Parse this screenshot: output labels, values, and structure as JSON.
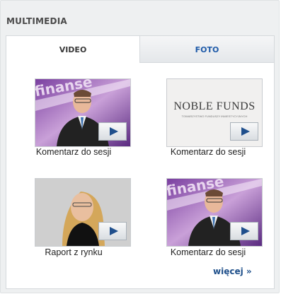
{
  "widget": {
    "title": "MULTIMEDIA"
  },
  "tabs": [
    {
      "label": "VIDEO",
      "active": true
    },
    {
      "label": "FOTO",
      "active": false
    }
  ],
  "videos": [
    {
      "caption": "Komentarz do sesji",
      "thumb": "finance-man"
    },
    {
      "caption": "Komentarz do sesji",
      "thumb": "noble-funds-logo",
      "logo_text": "NOBLE FUNDS",
      "logo_subtext": "TOWARZYSTWO FUNDUSZY INWESTYCYJNYCH"
    },
    {
      "caption": "Raport z rynku",
      "thumb": "woman-portrait"
    },
    {
      "caption": "Komentarz do sesji",
      "thumb": "finance-man"
    }
  ],
  "thumb_overlay_text": "finanse",
  "more_link": "więcej »",
  "colors": {
    "accent": "#1e5aa8",
    "panel_bg": "#eef0f1",
    "play_icon": "#1f4f8c"
  },
  "icons": {
    "play": "play-icon"
  }
}
